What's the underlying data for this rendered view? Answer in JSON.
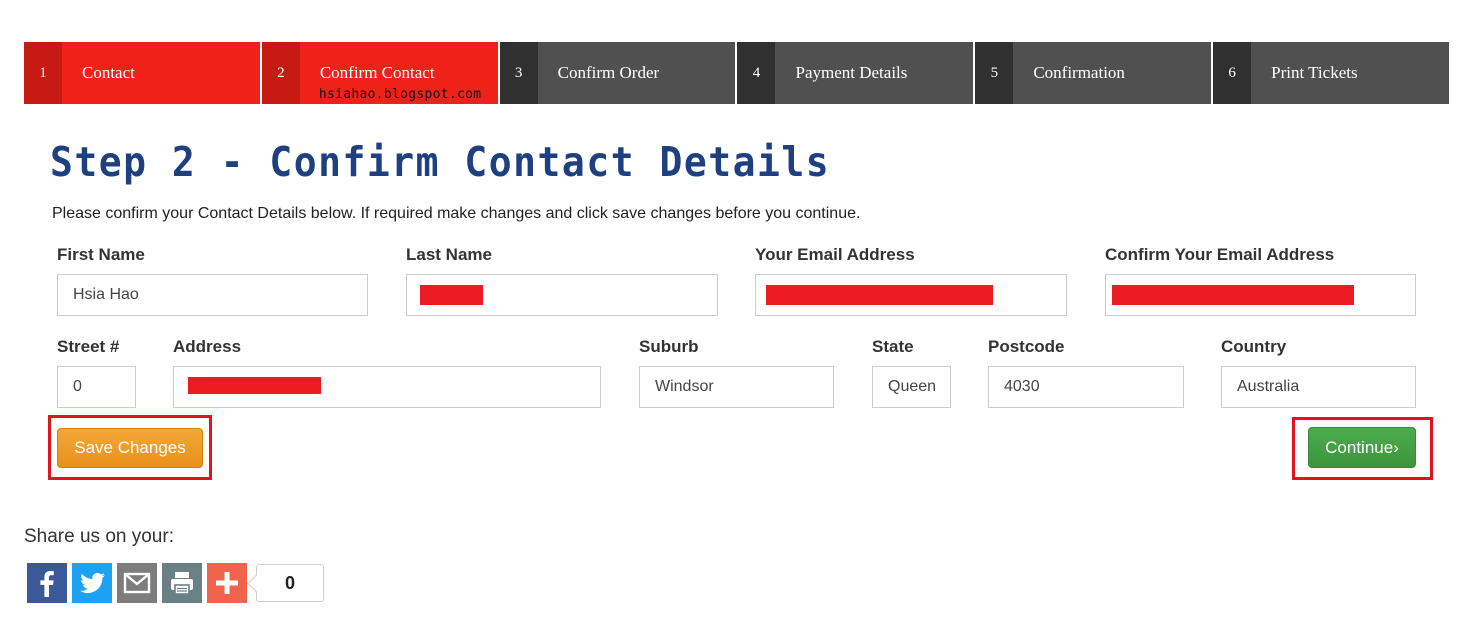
{
  "steps": [
    {
      "num": "1",
      "label": "Contact",
      "state": "active"
    },
    {
      "num": "2",
      "label": "Confirm Contact",
      "state": "active"
    },
    {
      "num": "3",
      "label": "Confirm Order",
      "state": "inactive"
    },
    {
      "num": "4",
      "label": "Payment Details",
      "state": "inactive"
    },
    {
      "num": "5",
      "label": "Confirmation",
      "state": "inactive"
    },
    {
      "num": "6",
      "label": "Print Tickets",
      "state": "inactive"
    }
  ],
  "watermark": "hsiahao.blogspot.com",
  "page": {
    "title": "Step 2 - Confirm Contact Details",
    "intro": "Please confirm your Contact Details below. If required make changes and click save changes before you continue."
  },
  "form": {
    "first_name": {
      "label": "First Name",
      "value": "Hsia Hao"
    },
    "last_name": {
      "label": "Last Name",
      "value": ""
    },
    "email": {
      "label": "Your Email Address",
      "value": ""
    },
    "confirm_email": {
      "label": "Confirm Your Email Address",
      "value": ""
    },
    "street_no": {
      "label": "Street #",
      "value": "0"
    },
    "address": {
      "label": "Address",
      "value": ""
    },
    "suburb": {
      "label": "Suburb",
      "value": "Windsor"
    },
    "state": {
      "label": "State",
      "value": "Queen"
    },
    "postcode": {
      "label": "Postcode",
      "value": "4030"
    },
    "country": {
      "label": "Country",
      "value": "Australia"
    }
  },
  "buttons": {
    "save": "Save Changes",
    "continue": "Continue›"
  },
  "share": {
    "title": "Share us on your:",
    "count": "0",
    "icons": [
      "facebook-icon",
      "twitter-icon",
      "email-icon",
      "print-icon",
      "more-icon"
    ]
  },
  "colors": {
    "step_active": "#ee2218",
    "step_inactive": "#505050",
    "title": "#1e4080",
    "save_button": "#e8911a",
    "continue_button": "#3c953c",
    "highlight": "#e0141e",
    "redaction": "#ed1c24"
  }
}
